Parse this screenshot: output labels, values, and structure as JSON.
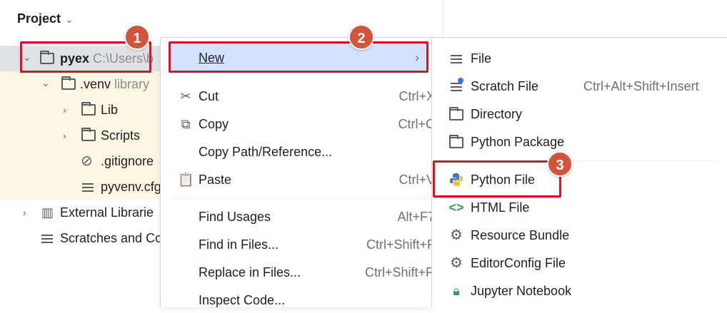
{
  "panel": {
    "title": "Project",
    "tree": [
      {
        "label": "pyex",
        "hint": "C:\\Users\\b",
        "icon": "folder-icon"
      },
      {
        "label": ".venv",
        "hint": "library",
        "icon": "folder-icon"
      },
      {
        "label": "Lib",
        "icon": "folder-icon"
      },
      {
        "label": "Scripts",
        "icon": "folder-icon"
      },
      {
        "label": ".gitignore",
        "icon": "ignored-file-icon"
      },
      {
        "label": "pyvenv.cfg",
        "icon": "text-file-icon"
      },
      {
        "label": "External Librarie",
        "icon": "library-icon"
      },
      {
        "label": "Scratches and Co",
        "icon": "scratches-icon"
      }
    ]
  },
  "menu": {
    "new": {
      "label": "New"
    },
    "cut": {
      "label": "Cut",
      "shortcut": "Ctrl+X"
    },
    "copy": {
      "label": "Copy",
      "shortcut": "Ctrl+C"
    },
    "copy_path": {
      "label": "Copy Path/Reference..."
    },
    "paste": {
      "label": "Paste",
      "shortcut": "Ctrl+V"
    },
    "find_usages": {
      "label": "Find Usages",
      "shortcut": "Alt+F7"
    },
    "find_in_files": {
      "label": "Find in Files...",
      "shortcut": "Ctrl+Shift+F"
    },
    "replace_in_files": {
      "label": "Replace in Files...",
      "shortcut": "Ctrl+Shift+R"
    },
    "inspect_code": {
      "label": "Inspect Code..."
    }
  },
  "submenu": {
    "file": {
      "label": "File"
    },
    "scratch_file": {
      "label": "Scratch File",
      "shortcut": "Ctrl+Alt+Shift+Insert"
    },
    "directory": {
      "label": "Directory"
    },
    "python_package": {
      "label": "Python Package"
    },
    "python_file": {
      "label": "Python File"
    },
    "html_file": {
      "label": "HTML File"
    },
    "resource_bundle": {
      "label": "Resource Bundle"
    },
    "editorconfig_file": {
      "label": "EditorConfig File"
    },
    "jupyter_notebook": {
      "label": "Jupyter Notebook"
    }
  },
  "callouts": {
    "step1": "1",
    "step2": "2",
    "step3": "3"
  },
  "colors": {
    "callout": "#e0101e",
    "badge": "#d2543a",
    "menu_highlight": "#d4e2ff",
    "tree_highlight": "#fdf6e3"
  }
}
